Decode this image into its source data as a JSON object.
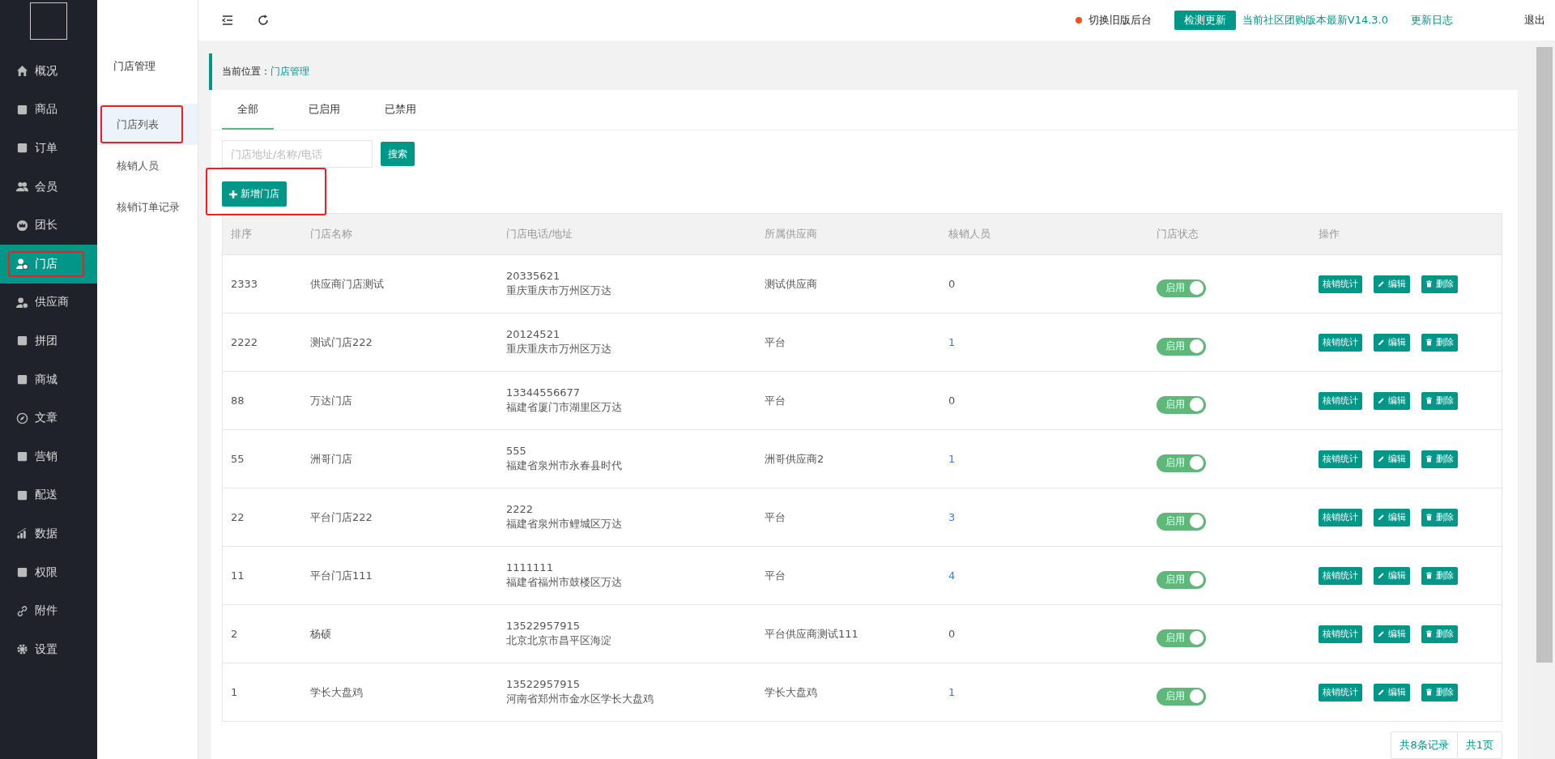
{
  "sidebar": {
    "items": [
      {
        "label": "概况",
        "selected": false,
        "highlighted": false
      },
      {
        "label": "商品",
        "selected": false,
        "highlighted": false
      },
      {
        "label": "订单",
        "selected": false,
        "highlighted": false
      },
      {
        "label": "会员",
        "selected": false,
        "highlighted": false
      },
      {
        "label": "团长",
        "selected": false,
        "highlighted": false
      },
      {
        "label": "门店",
        "selected": true,
        "highlighted": true
      },
      {
        "label": "供应商",
        "selected": false,
        "highlighted": false
      },
      {
        "label": "拼团",
        "selected": false,
        "highlighted": false
      },
      {
        "label": "商城",
        "selected": false,
        "highlighted": false
      },
      {
        "label": "文章",
        "selected": false,
        "highlighted": false
      },
      {
        "label": "营销",
        "selected": false,
        "highlighted": false
      },
      {
        "label": "配送",
        "selected": false,
        "highlighted": false
      },
      {
        "label": "数据",
        "selected": false,
        "highlighted": false
      },
      {
        "label": "权限",
        "selected": false,
        "highlighted": false
      },
      {
        "label": "附件",
        "selected": false,
        "highlighted": false
      },
      {
        "label": "设置",
        "selected": false,
        "highlighted": false
      }
    ]
  },
  "subnav": {
    "title": "门店管理",
    "items": [
      {
        "label": "门店列表",
        "selected": true,
        "highlighted": true
      },
      {
        "label": "核销人员",
        "selected": false,
        "highlighted": false
      },
      {
        "label": "核销订单记录",
        "selected": false,
        "highlighted": false
      }
    ]
  },
  "topbar": {
    "switch_link": "切换旧版后台",
    "check_button": "检测更新",
    "version": "当前社区团购版本最新V14.3.0",
    "changelog": "更新日志",
    "logout": "退出"
  },
  "breadcrumb": {
    "label": "当前位置：",
    "current": "门店管理"
  },
  "tabs": [
    {
      "label": "全部",
      "selected": true
    },
    {
      "label": "已启用",
      "selected": false
    },
    {
      "label": "已禁用",
      "selected": false
    }
  ],
  "search": {
    "placeholder": "门店地址/名称/电话",
    "button": "搜索"
  },
  "add_button": {
    "label": "新增门店",
    "highlighted": true
  },
  "table": {
    "columns": [
      "排序",
      "门店名称",
      "门店电话/地址",
      "所属供应商",
      "核销人员",
      "门店状态",
      "操作"
    ],
    "rows": [
      {
        "order": "2333",
        "name": "供应商门店测试",
        "phone": "20335621",
        "address": "重庆重庆市万州区万达",
        "supplier": "测试供应商",
        "verifiers": "0",
        "verifiers_linked": false,
        "status": "启用",
        "on": true,
        "actions": [
          "核销统计",
          "编辑",
          "删除"
        ]
      },
      {
        "order": "2222",
        "name": "测试门店222",
        "phone": "20124521",
        "address": "重庆重庆市万州区万达",
        "supplier": "平台",
        "verifiers": "1",
        "verifiers_linked": true,
        "status": "启用",
        "on": true,
        "actions": [
          "核销统计",
          "编辑",
          "删除"
        ]
      },
      {
        "order": "88",
        "name": "万达门店",
        "phone": "13344556677",
        "address": "福建省厦门市湖里区万达",
        "supplier": "平台",
        "verifiers": "0",
        "verifiers_linked": false,
        "status": "启用",
        "on": true,
        "actions": [
          "核销统计",
          "编辑",
          "删除"
        ]
      },
      {
        "order": "55",
        "name": "洲哥门店",
        "phone": "555",
        "address": "福建省泉州市永春县时代",
        "supplier": "洲哥供应商2",
        "verifiers": "1",
        "verifiers_linked": true,
        "status": "启用",
        "on": true,
        "actions": [
          "核销统计",
          "编辑",
          "删除"
        ]
      },
      {
        "order": "22",
        "name": "平台门店222",
        "phone": "2222",
        "address": "福建省泉州市鲤城区万达",
        "supplier": "平台",
        "verifiers": "3",
        "verifiers_linked": true,
        "status": "启用",
        "on": true,
        "actions": [
          "核销统计",
          "编辑",
          "删除"
        ]
      },
      {
        "order": "11",
        "name": "平台门店111",
        "phone": "1111111",
        "address": "福建省福州市鼓楼区万达",
        "supplier": "平台",
        "verifiers": "4",
        "verifiers_linked": true,
        "status": "启用",
        "on": true,
        "actions": [
          "核销统计",
          "编辑",
          "删除"
        ]
      },
      {
        "order": "2",
        "name": "杨硕",
        "phone": "13522957915",
        "address": "北京北京市昌平区海淀",
        "supplier": "平台供应商测试111",
        "verifiers": "0",
        "verifiers_linked": false,
        "status": "启用",
        "on": true,
        "actions": [
          "核销统计",
          "编辑",
          "删除"
        ]
      },
      {
        "order": "1",
        "name": "学长大盘鸡",
        "phone": "13522957915",
        "address": "河南省郑州市金水区学长大盘鸡",
        "supplier": "学长大盘鸡",
        "verifiers": "1",
        "verifiers_linked": true,
        "status": "启用",
        "on": true,
        "actions": [
          "核销统计",
          "编辑",
          "删除"
        ]
      }
    ]
  },
  "pagination": {
    "total": "共8条记录",
    "pages": "共1页"
  }
}
